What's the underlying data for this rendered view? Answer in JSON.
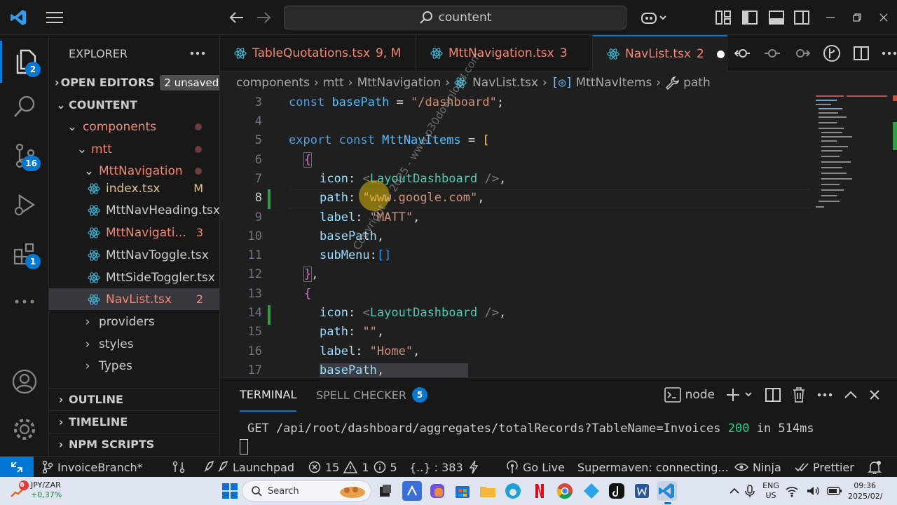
{
  "titlebar": {
    "command_center_text": "countent"
  },
  "activity_bar": {
    "explorer_badge": "2",
    "source_control_badge": "16",
    "extensions_badge": "1"
  },
  "sidebar": {
    "title": "EXPLORER",
    "open_editors": {
      "label": "OPEN EDITORS",
      "badge": "2 unsaved"
    },
    "root": "COUNTENT",
    "tree": [
      {
        "label": "components",
        "color": "#f48771"
      },
      {
        "label": "mtt",
        "color": "#f48771"
      },
      {
        "label": "MttNavigation",
        "color": "#f48771"
      },
      {
        "label": "index.tsx",
        "status": "M",
        "color": "#e2c08d"
      },
      {
        "label": "MttNavHeading.tsx",
        "status": "",
        "color": "#cccccc"
      },
      {
        "label": "MttNavigati...",
        "status": "3",
        "color": "#f48771"
      },
      {
        "label": "MttNavToggle.tsx",
        "status": "",
        "color": "#cccccc"
      },
      {
        "label": "MttSideToggler.tsx",
        "status": "",
        "color": "#cccccc"
      },
      {
        "label": "NavList.tsx",
        "status": "2",
        "color": "#f48771"
      },
      {
        "label": "providers"
      },
      {
        "label": "styles"
      },
      {
        "label": "Types"
      }
    ],
    "sections": [
      "OUTLINE",
      "TIMELINE",
      "NPM SCRIPTS"
    ]
  },
  "tabs": [
    {
      "name": "TableQuotations.tsx",
      "status": "9, M"
    },
    {
      "name": "MttNavigation.tsx",
      "status": "3"
    },
    {
      "name": "NavList.tsx",
      "status": "2"
    }
  ],
  "breadcrumbs": [
    "components",
    "mtt",
    "MttNavigation",
    "NavList.tsx",
    "MttNavItems",
    "path"
  ],
  "editor": {
    "line_numbers": [
      "3",
      "4",
      "5",
      "6",
      "7",
      "8",
      "9",
      "10",
      "11",
      "12",
      "13",
      "14",
      "15",
      "16",
      "17"
    ],
    "tokens": {
      "const": "const",
      "export": "export",
      "basePath": "basePath",
      "dashboard_str": "\"/dashboard\"",
      "MttNavItems": "MttNavItems",
      "icon": "icon",
      "LayoutDashboard": "LayoutDashboard",
      "path": "path",
      "google_str": "\"www.google.com\"",
      "label": "label",
      "matt_str": "\"MATT\"",
      "subMenu": "subMenu",
      "empty_str": "\"\"",
      "home_str": "\"Home\""
    }
  },
  "panel": {
    "tabs": [
      {
        "label": "TERMINAL"
      },
      {
        "label": "SPELL CHECKER",
        "badge": "5"
      }
    ],
    "shell": "node",
    "terminal_request": "GET /api/root/dashboard/aggregates/totalRecords?TableName=Invoices ",
    "terminal_status": "200",
    "terminal_tail": " in 514ms"
  },
  "statusbar": {
    "branch": "InvoiceBranch*",
    "launchpad": "Launchpad",
    "errors": "15",
    "warnings": "1",
    "infos": "5",
    "symbols": "{..} : 383",
    "go_live": "Go Live",
    "supermaven": "Supermaven: connecting...",
    "ninja": "Ninja",
    "prettier": "Prettier"
  },
  "taskbar": {
    "currency_pair": "JPY/ZAR",
    "currency_change": "+0,37%",
    "currency_badge": "6",
    "search_label": "Search",
    "lang_top": "ENG",
    "lang_bottom": "US",
    "time": "09:36",
    "date": "2025/02/"
  },
  "watermark": "Copyright © 2025 - www.p30download.com"
}
